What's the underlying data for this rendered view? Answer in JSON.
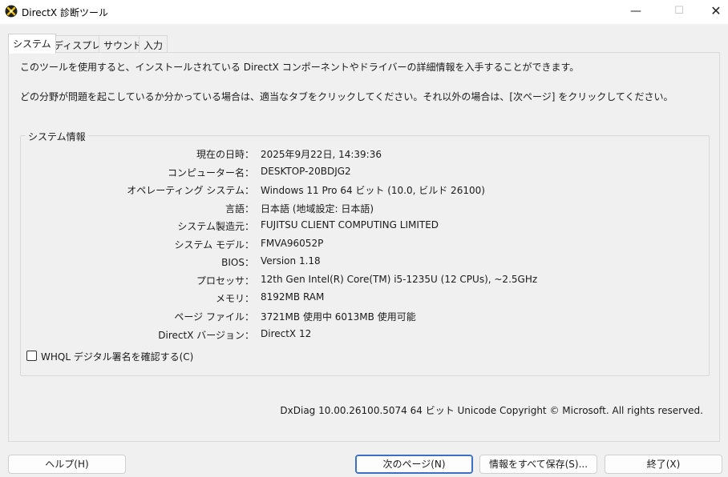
{
  "window": {
    "title": "DirectX 診断ツール",
    "minimize": "—",
    "maximize": "☐",
    "close": "✕"
  },
  "tabs": [
    {
      "label": "システム",
      "active": true
    },
    {
      "label": "ディスプレイ",
      "active": false
    },
    {
      "label": "サウンド",
      "active": false
    },
    {
      "label": "入力",
      "active": false
    }
  ],
  "intro": {
    "line1": "このツールを使用すると、インストールされている DirectX コンポーネントやドライバーの詳細情報を入手することができます。",
    "line2": "どの分野が問題を起こしているか分かっている場合は、適当なタブをクリックしてください。それ以外の場合は、[次ページ] をクリックしてください。"
  },
  "system_info": {
    "legend": "システム情報",
    "rows": [
      {
        "label": "現在の日時：",
        "value": "2025年9月22日, 14:39:36"
      },
      {
        "label": "コンピューター名：",
        "value": "DESKTOP-20BDJG2"
      },
      {
        "label": "オペレーティング システム：",
        "value": "Windows 11 Pro 64 ビット (10.0, ビルド 26100)"
      },
      {
        "label": "言語：",
        "value": "日本語 (地域設定: 日本語)"
      },
      {
        "label": "システム製造元：",
        "value": "FUJITSU CLIENT COMPUTING LIMITED"
      },
      {
        "label": "システム モデル：",
        "value": "FMVA96052P"
      },
      {
        "label": "BIOS：",
        "value": "Version 1.18"
      },
      {
        "label": "プロセッサ：",
        "value": "12th Gen Intel(R) Core(TM) i5-1235U (12 CPUs), ~2.5GHz"
      },
      {
        "label": "メモリ：",
        "value": "8192MB RAM"
      },
      {
        "label": "ページ ファイル：",
        "value": "3721MB 使用中 6013MB 使用可能"
      },
      {
        "label": "DirectX バージョン：",
        "value": "DirectX 12"
      }
    ],
    "whql_label": "WHQL デジタル署名を確認する(C)",
    "whql_checked": false
  },
  "footer": {
    "info": "DxDiag 10.00.26100.5074 64 ビット Unicode  Copyright © Microsoft. All rights reserved."
  },
  "buttons": {
    "help": "ヘルプ(H)",
    "next": "次のページ(N)",
    "save": "情報をすべて保存(S)...",
    "exit": "終了(X)"
  },
  "colors": {
    "window_bg": "#f0f0f0",
    "titlebar_bg": "#ffffff",
    "default_button_border": "#3a6fc4"
  }
}
